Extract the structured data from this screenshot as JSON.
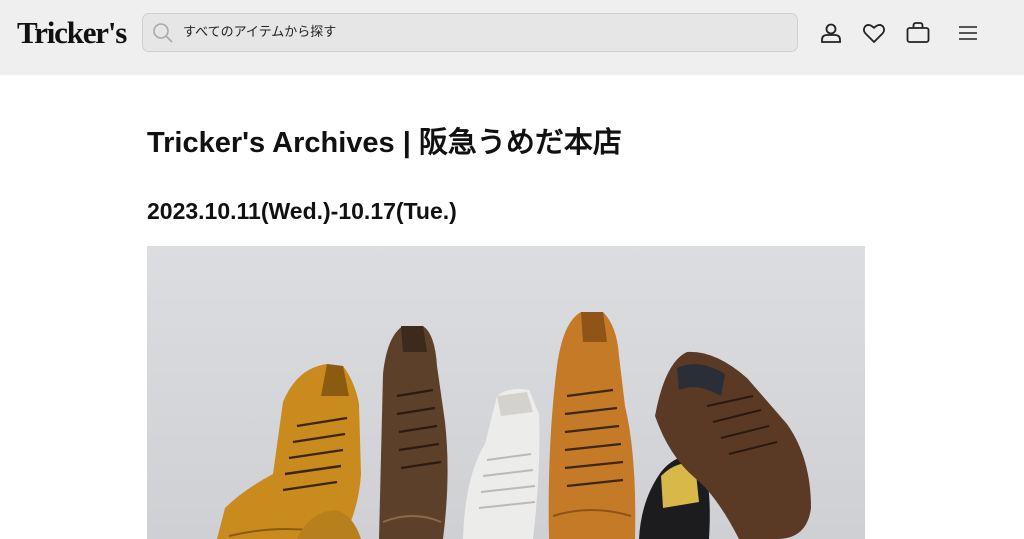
{
  "header": {
    "logo_text": "Tricker's",
    "search": {
      "placeholder": "すべてのアイテムから探す"
    },
    "icons": [
      "user-icon",
      "heart-icon",
      "bag-icon",
      "menu-icon"
    ]
  },
  "main": {
    "title": "Tricker's Archives | 阪急うめだ本店",
    "date": "2023.10.11(Wed.)-10.17(Tue.)",
    "hero_image": {
      "subject": "shoes-photo"
    }
  },
  "colors": {
    "header_bg": "#efefef",
    "search_bg": "#e6e6e6",
    "text": "#111111",
    "page_bg": "#ffffff"
  }
}
